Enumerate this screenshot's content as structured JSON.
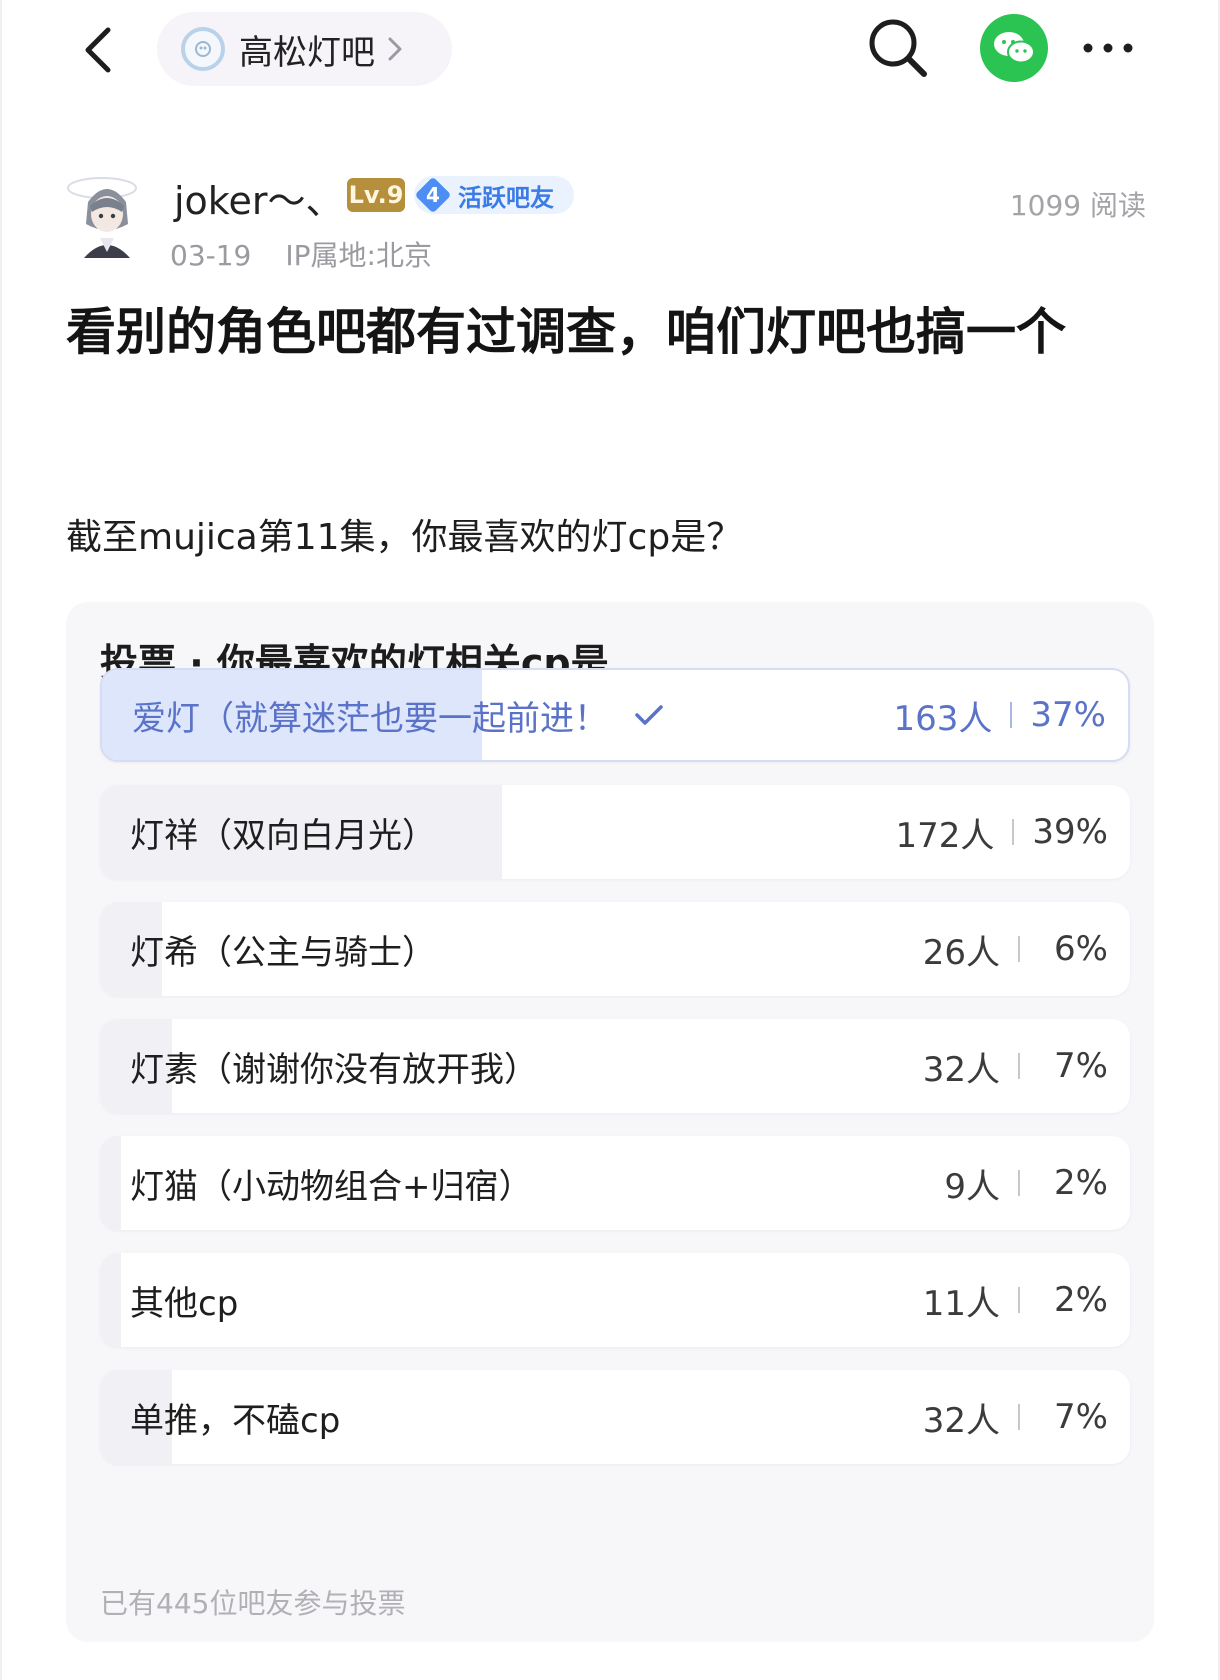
{
  "nav": {
    "forum_name": "高松灯吧",
    "back_icon": "back-arrow-icon",
    "search_icon": "search-icon",
    "share_icon": "wechat-icon",
    "more_icon": "more-icon"
  },
  "author": {
    "username": "joker～、",
    "level": "Lv.9",
    "badge_level": "4",
    "badge_text": "活跃吧友",
    "date": "03-19",
    "ip_location": "IP属地:北京",
    "read_count": "1099 阅读"
  },
  "post": {
    "title": "看别的角色吧都有过调查，咱们灯吧也搞一个",
    "body": "截至mujica第11集，你最喜欢的灯cp是？"
  },
  "poll": {
    "title": "投票 · 你最喜欢的灯相关cp是",
    "options": [
      {
        "label": "爱灯（就算迷茫也要一起前进！",
        "count": "163人",
        "percent": "37%",
        "selected": true,
        "fraction": 0.37
      },
      {
        "label": "灯祥（双向白月光）",
        "count": "172人",
        "percent": "39%",
        "selected": false,
        "fraction": 0.39
      },
      {
        "label": "灯希（公主与骑士）",
        "count": "26人",
        "percent": "6%",
        "selected": false,
        "fraction": 0.06
      },
      {
        "label": "灯素（谢谢你没有放开我）",
        "count": "32人",
        "percent": "7%",
        "selected": false,
        "fraction": 0.07
      },
      {
        "label": "灯猫（小动物组合+归宿）",
        "count": "9人",
        "percent": "2%",
        "selected": false,
        "fraction": 0.02
      },
      {
        "label": "其他cp",
        "count": "11人",
        "percent": "2%",
        "selected": false,
        "fraction": 0.02
      },
      {
        "label": "单推，不磕cp",
        "count": "32人",
        "percent": "7%",
        "selected": false,
        "fraction": 0.07
      }
    ],
    "footer": "已有445位吧友参与投票"
  },
  "colors": {
    "accent": "#5a73c9",
    "selected_fill": "#dde6fb",
    "wechat_green": "#2bc453",
    "level_gold": "#b58f3c",
    "badge_blue": "#4d8ef5"
  }
}
